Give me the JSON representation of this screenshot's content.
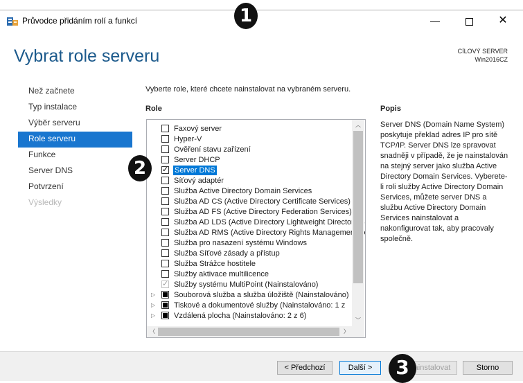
{
  "window": {
    "title": "Průvodce přidáním rolí a funkcí",
    "minimize": "—",
    "close": "✕"
  },
  "header": {
    "page_title": "Vybrat role serveru",
    "target_label": "CÍLOVÝ SERVER",
    "target_name": "Win2016CZ"
  },
  "nav": {
    "items": [
      {
        "label": "Než začnete"
      },
      {
        "label": "Typ instalace"
      },
      {
        "label": "Výběr serveru"
      },
      {
        "label": "Role serveru"
      },
      {
        "label": "Funkce"
      },
      {
        "label": "Server DNS"
      },
      {
        "label": "Potvrzení"
      },
      {
        "label": "Výsledky"
      }
    ]
  },
  "main": {
    "instruction": "Vyberte role, které chcete nainstalovat na vybraném serveru.",
    "roles_heading": "Role",
    "description_heading": "Popis",
    "roles": [
      {
        "label": "Faxový server",
        "checked": false
      },
      {
        "label": "Hyper-V",
        "checked": false
      },
      {
        "label": "Ověření stavu zařízení",
        "checked": false
      },
      {
        "label": "Server DHCP",
        "checked": false
      },
      {
        "label": "Server DNS",
        "checked": true,
        "selected": true
      },
      {
        "label": "Síťový adaptér",
        "checked": false
      },
      {
        "label": "Služba Active Directory Domain Services",
        "checked": false
      },
      {
        "label": "Služba AD CS (Active Directory Certificate Services)",
        "checked": false
      },
      {
        "label": "Služba AD FS (Active Directory Federation Services)",
        "checked": false
      },
      {
        "label": "Služba AD LDS (Active Directory Lightweight Directory Services)",
        "checked": false
      },
      {
        "label": "Služba AD RMS (Active Directory Rights Management Services)",
        "checked": false
      },
      {
        "label": "Služba pro nasazení systému Windows",
        "checked": false
      },
      {
        "label": "Služba Síťové zásady a přístup",
        "checked": false
      },
      {
        "label": "Služba Strážce hostitele",
        "checked": false
      },
      {
        "label": "Služby aktivace multilicence",
        "checked": false
      },
      {
        "label": "Služby systému MultiPoint (Nainstalováno)",
        "checked": true,
        "disabled": true
      },
      {
        "label": "Souborová služba a služba úložiště (Nainstalováno)",
        "partial": true,
        "expandable": true
      },
      {
        "label": "Tiskové a dokumentové služby (Nainstalováno: 1 z",
        "partial": true,
        "expandable": true
      },
      {
        "label": "Vzdálená plocha (Nainstalováno: 2 z 6)",
        "partial": true,
        "expandable": true
      }
    ],
    "description": "Server DNS (Domain Name System) poskytuje překlad adres IP pro sítě TCP/IP. Server DNS lze spravovat snadněji v případě, že je nainstalován na stejný server jako služba Active Directory Domain Services. Vyberete-li roli služby Active Directory Domain Services, můžete server DNS a službu Active Directory Domain Services nainstalovat a nakonfigurovat tak, aby pracovaly společně."
  },
  "footer": {
    "prev": "< Předchozí",
    "next": "Další >",
    "install": "Nainstalovat",
    "cancel": "Storno"
  },
  "annotations": [
    "1",
    "2",
    "3"
  ]
}
